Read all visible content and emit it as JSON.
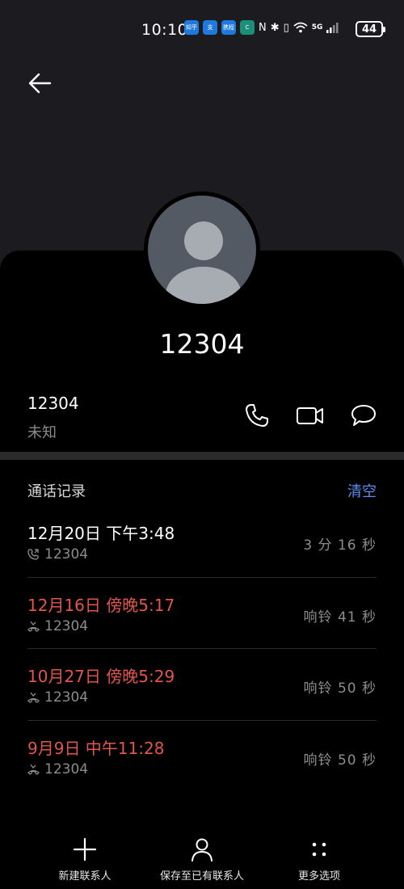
{
  "status_bar": {
    "time": "10:10",
    "app_icons": [
      {
        "name": "zhihu-icon",
        "text": "知乎"
      },
      {
        "name": "alipay-icon",
        "text": "支"
      },
      {
        "name": "ctrip-icon",
        "text": "携程"
      },
      {
        "name": "app-c-icon",
        "text": "C"
      }
    ],
    "battery": "44",
    "network": "5G"
  },
  "contact": {
    "name": "12304",
    "number": "12304",
    "location": "未知"
  },
  "call_log": {
    "title": "通话记录",
    "clear_label": "清空",
    "entries": [
      {
        "date": "12月20日 下午3:48",
        "number": "12304",
        "duration": "3 分 16 秒",
        "missed": false
      },
      {
        "date": "12月16日 傍晚5:17",
        "number": "12304",
        "duration": "响铃 41 秒",
        "missed": true
      },
      {
        "date": "10月27日 傍晚5:29",
        "number": "12304",
        "duration": "响铃 50 秒",
        "missed": true
      },
      {
        "date": "9月9日 中午11:28",
        "number": "12304",
        "duration": "响铃 50 秒",
        "missed": true
      }
    ]
  },
  "bottom_bar": {
    "new_contact": "新建联系人",
    "save_existing": "保存至已有联系人",
    "more_options": "更多选项"
  },
  "colors": {
    "background": "#1c1c20",
    "card": "#000000",
    "missed": "#e0564c",
    "accent": "#5b8ef0"
  }
}
